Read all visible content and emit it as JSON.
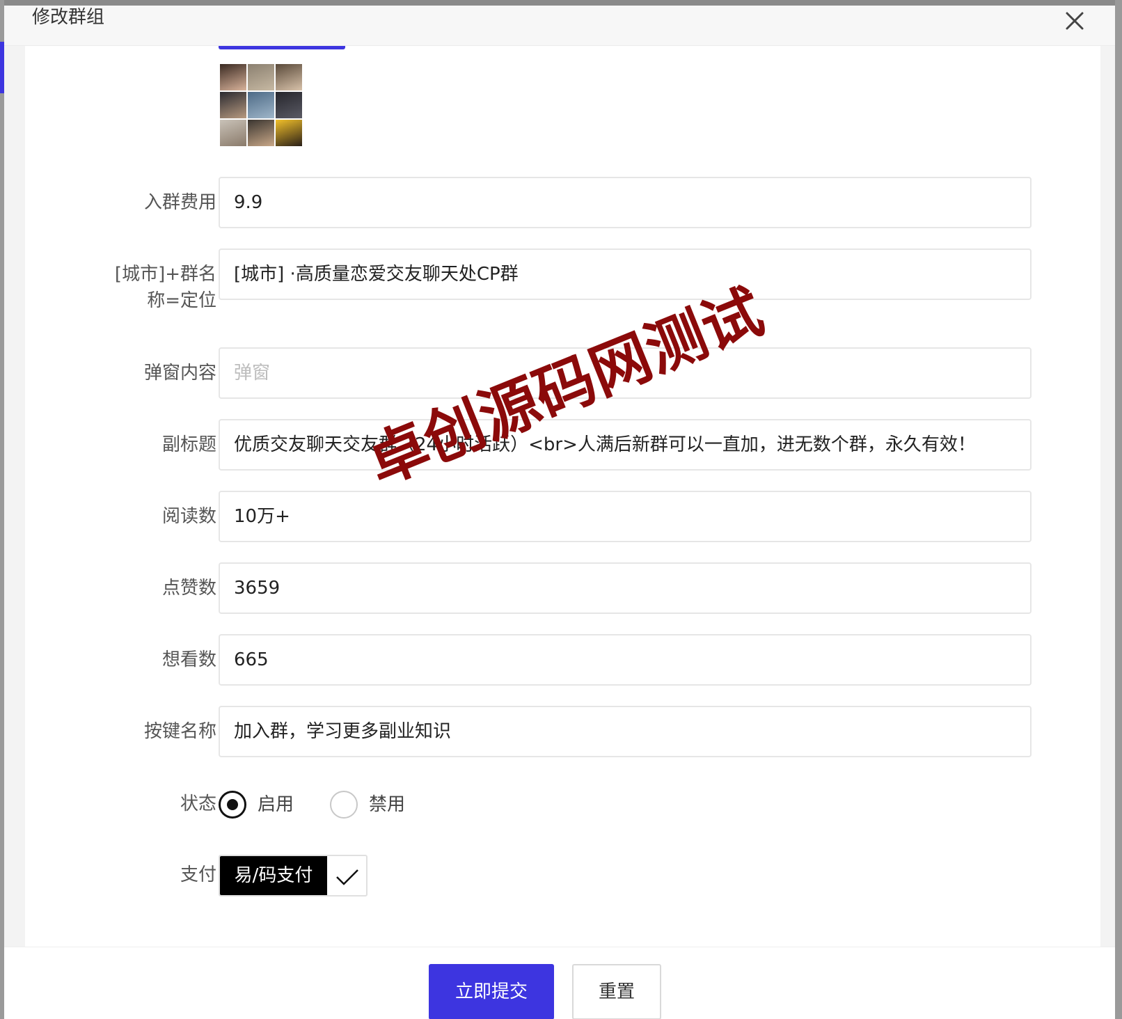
{
  "modal": {
    "title": "修改群组"
  },
  "form": {
    "fields": [
      {
        "label": "入群费用",
        "value": "9.9",
        "placeholder": ""
      },
      {
        "label_lines": [
          "[城市]+群名",
          "称=定位"
        ],
        "value": "[城市] ·高质量恋爱交友聊天处CP群",
        "placeholder": ""
      },
      {
        "label": "弹窗内容",
        "value": "",
        "placeholder": "弹窗"
      },
      {
        "label": "副标题",
        "value": "优质交友聊天交友群（24小时活跃）<br>人满后新群可以一直加，进无数个群，永久有效！",
        "placeholder": ""
      },
      {
        "label": "阅读数",
        "value": "10万+",
        "placeholder": ""
      },
      {
        "label": "点赞数",
        "value": "3659",
        "placeholder": ""
      },
      {
        "label": "想看数",
        "value": "665",
        "placeholder": ""
      },
      {
        "label": "按键名称",
        "value": "加入群，学习更多副业知识",
        "placeholder": ""
      }
    ],
    "status": {
      "label": "状态",
      "options": [
        "启用",
        "禁用"
      ],
      "selected": "启用"
    },
    "payment": {
      "label": "支付",
      "selected": "易/码支付"
    }
  },
  "footer": {
    "submit_label": "立即提交",
    "reset_label": "重置"
  },
  "watermark": {
    "text": "卓创源码网测试",
    "color": "#8b0a0a"
  },
  "colors": {
    "accent": "#3d35e0",
    "tag_bg": "#000000"
  },
  "avatars": [
    {
      "name": "avatar-1",
      "colors": [
        "#3a2a22",
        "#d9b39b"
      ]
    },
    {
      "name": "avatar-2",
      "colors": [
        "#8b8070",
        "#c7b9a3"
      ]
    },
    {
      "name": "avatar-3",
      "colors": [
        "#5a4a3a",
        "#d8c2aa"
      ]
    },
    {
      "name": "avatar-4",
      "colors": [
        "#2a2a30",
        "#b89a80"
      ]
    },
    {
      "name": "avatar-5",
      "colors": [
        "#4d6a86",
        "#9fb6c9"
      ]
    },
    {
      "name": "avatar-6",
      "colors": [
        "#26262c",
        "#5a5a64"
      ]
    },
    {
      "name": "avatar-7",
      "colors": [
        "#c9c2b8",
        "#8a7a6a"
      ]
    },
    {
      "name": "avatar-8",
      "colors": [
        "#3a3530",
        "#c9a888"
      ]
    },
    {
      "name": "avatar-9",
      "colors": [
        "#f2c02a",
        "#2a2018"
      ]
    }
  ]
}
